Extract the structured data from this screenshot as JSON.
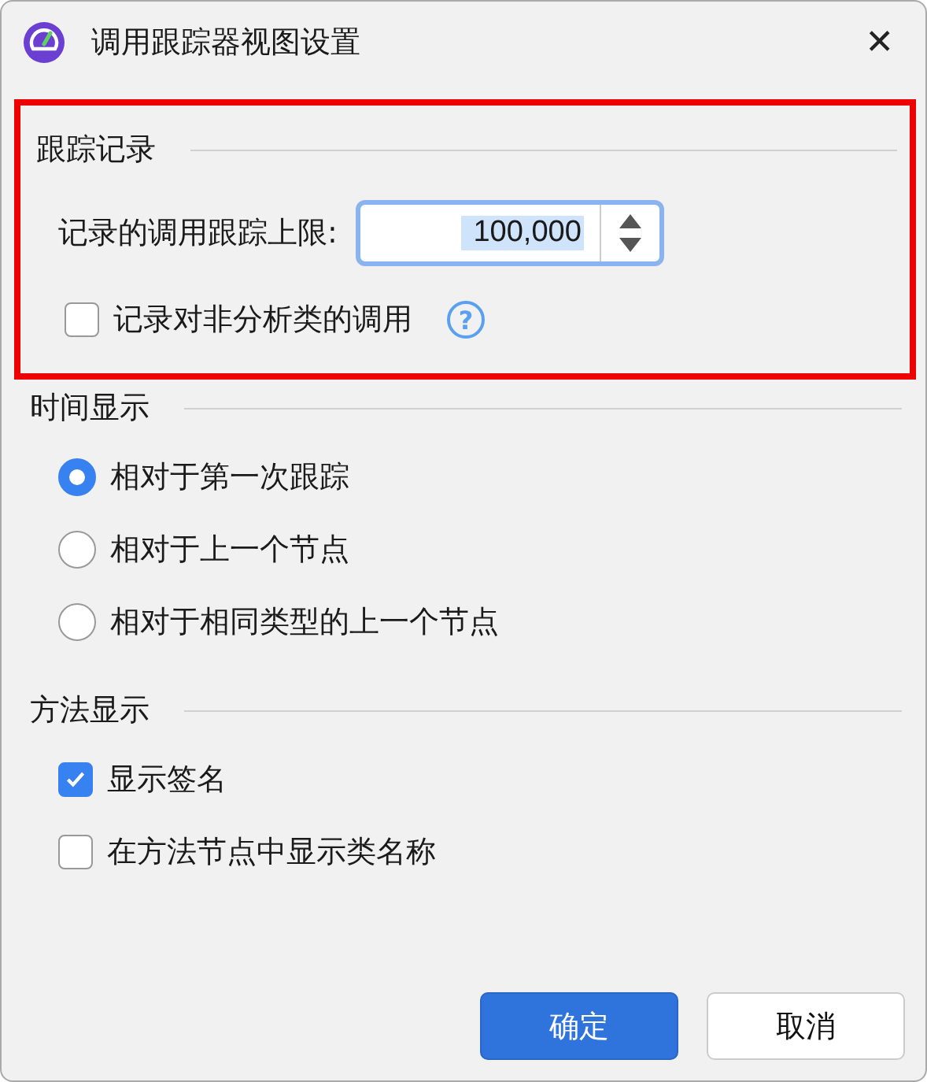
{
  "window": {
    "title": "调用跟踪器视图设置",
    "close": "✕"
  },
  "trace_section": {
    "title": "跟踪记录",
    "highlighted": true,
    "limit_label": "记录的调用跟踪上限:",
    "limit_value": "100,000",
    "value_selected": true,
    "record_non_profiled": {
      "label": "记录对非分析类的调用",
      "checked": false
    },
    "help": "?"
  },
  "time_section": {
    "title": "时间显示",
    "options": [
      {
        "label": "相对于第一次跟踪",
        "selected": true
      },
      {
        "label": "相对于上一个节点",
        "selected": false
      },
      {
        "label": "相对于相同类型的上一个节点",
        "selected": false
      }
    ]
  },
  "method_section": {
    "title": "方法显示",
    "options": [
      {
        "label": "显示签名",
        "checked": true
      },
      {
        "label": "在方法节点中显示类名称",
        "checked": false
      }
    ]
  },
  "buttons": [
    {
      "label": "确定",
      "primary": true
    },
    {
      "label": "取消",
      "primary": false
    }
  ]
}
